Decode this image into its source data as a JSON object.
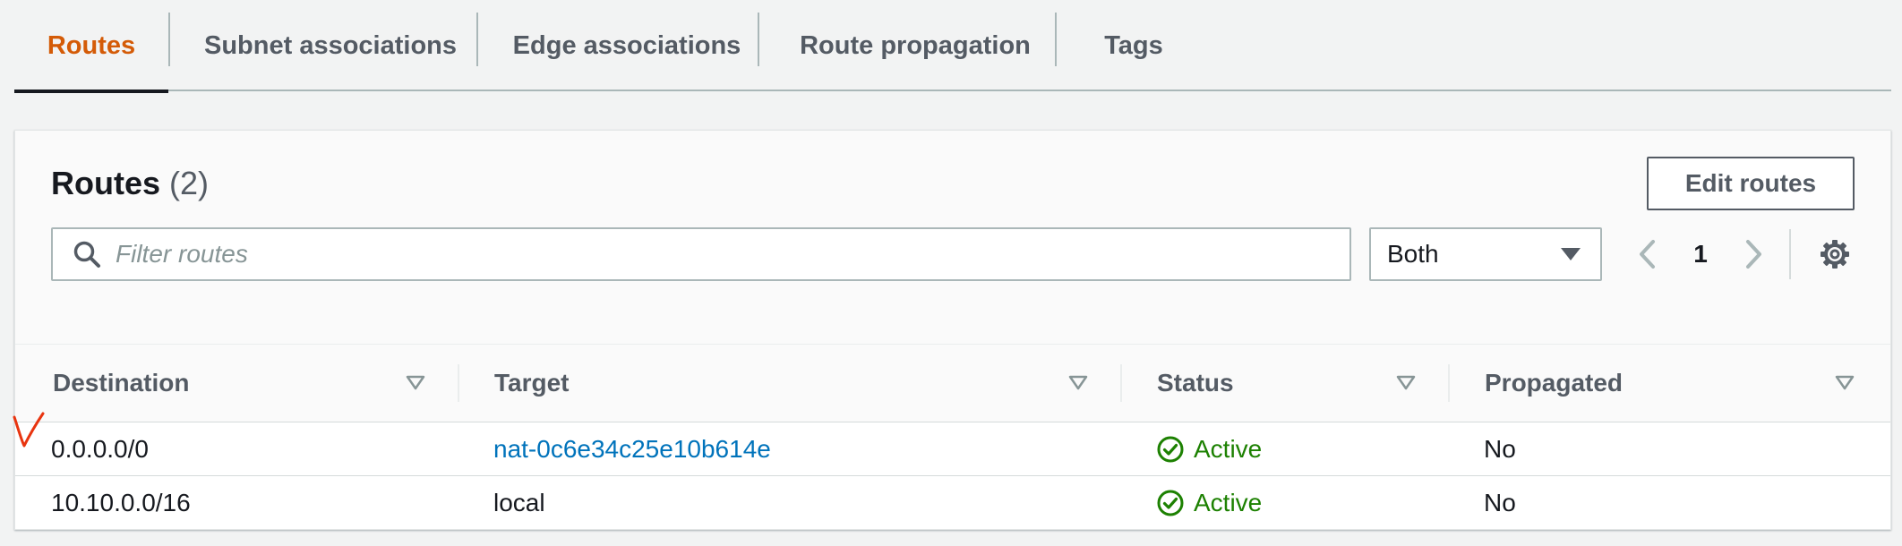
{
  "tabs": [
    {
      "label": "Routes",
      "active": true
    },
    {
      "label": "Subnet associations",
      "active": false
    },
    {
      "label": "Edge associations",
      "active": false
    },
    {
      "label": "Route propagation",
      "active": false
    },
    {
      "label": "Tags",
      "active": false
    }
  ],
  "routes_panel": {
    "title": "Routes",
    "count": "(2)",
    "edit_button": "Edit routes",
    "filter_placeholder": "Filter routes",
    "filter_value": "",
    "scope_select": "Both",
    "page_current": "1"
  },
  "table": {
    "columns": [
      "Destination",
      "Target",
      "Status",
      "Propagated"
    ],
    "rows": [
      {
        "destination": "0.0.0.0/0",
        "target": "nat-0c6e34c25e10b614e",
        "target_is_link": true,
        "status": "Active",
        "propagated": "No"
      },
      {
        "destination": "10.10.0.0/16",
        "target": "local",
        "target_is_link": false,
        "status": "Active",
        "propagated": "No"
      }
    ]
  },
  "icons": {
    "search": "search-icon",
    "caret": "caret-down-icon",
    "prev": "chevron-left-icon",
    "next": "chevron-right-icon",
    "settings": "gear-icon",
    "sort": "sort-down-icon",
    "status": "check-circle-icon",
    "annotation": "red-check-mark-icon"
  },
  "colors": {
    "accent_orange": "#d45b07",
    "link_blue": "#0073bb",
    "status_green": "#1d8102",
    "annotation_red": "#e8340f"
  }
}
